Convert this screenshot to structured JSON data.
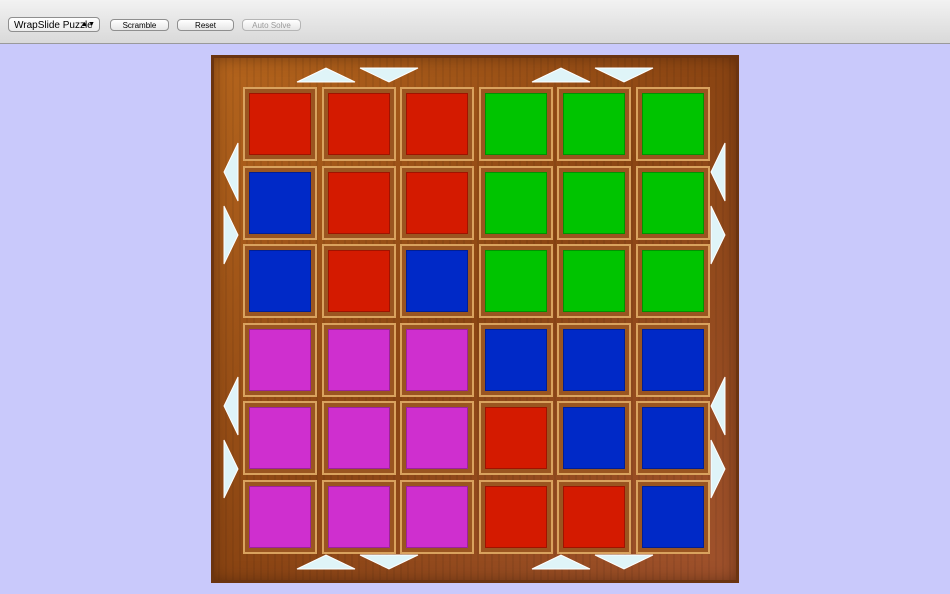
{
  "toolbar": {
    "puzzle_select": {
      "selected": "WrapSlide Puzzle",
      "icon": "updown-chevron-icon"
    },
    "buttons": [
      {
        "id": "scramble",
        "label": "Scramble",
        "enabled": true
      },
      {
        "id": "reset",
        "label": "Reset",
        "enabled": true
      },
      {
        "id": "auto_solve",
        "label": "Auto Solve",
        "enabled": false
      }
    ]
  },
  "colors": {
    "background": "#c9c9fb",
    "red": "#d41a00",
    "green": "#00c400",
    "blue": "#0029c7",
    "magenta": "#cf2fcf",
    "arrow": "#dff4f8"
  },
  "board": {
    "size": 6,
    "tiles": [
      [
        "red",
        "red",
        "red",
        "green",
        "green",
        "green"
      ],
      [
        "blue",
        "red",
        "red",
        "green",
        "green",
        "green"
      ],
      [
        "blue",
        "red",
        "blue",
        "green",
        "green",
        "green"
      ],
      [
        "magenta",
        "magenta",
        "magenta",
        "blue",
        "blue",
        "blue"
      ],
      [
        "magenta",
        "magenta",
        "magenta",
        "red",
        "blue",
        "blue"
      ],
      [
        "magenta",
        "magenta",
        "magenta",
        "red",
        "red",
        "blue"
      ]
    ],
    "arrows": [
      {
        "side": "top",
        "half": "left",
        "direction": "up"
      },
      {
        "side": "top",
        "half": "left",
        "direction": "down"
      },
      {
        "side": "top",
        "half": "right",
        "direction": "up"
      },
      {
        "side": "top",
        "half": "right",
        "direction": "down"
      },
      {
        "side": "bottom",
        "half": "left",
        "direction": "up"
      },
      {
        "side": "bottom",
        "half": "left",
        "direction": "down"
      },
      {
        "side": "bottom",
        "half": "right",
        "direction": "up"
      },
      {
        "side": "bottom",
        "half": "right",
        "direction": "down"
      },
      {
        "side": "left",
        "half": "top",
        "direction": "left"
      },
      {
        "side": "left",
        "half": "top",
        "direction": "right"
      },
      {
        "side": "left",
        "half": "bottom",
        "direction": "left"
      },
      {
        "side": "left",
        "half": "bottom",
        "direction": "right"
      },
      {
        "side": "right",
        "half": "top",
        "direction": "left"
      },
      {
        "side": "right",
        "half": "top",
        "direction": "right"
      },
      {
        "side": "right",
        "half": "bottom",
        "direction": "left"
      },
      {
        "side": "right",
        "half": "bottom",
        "direction": "right"
      }
    ]
  }
}
